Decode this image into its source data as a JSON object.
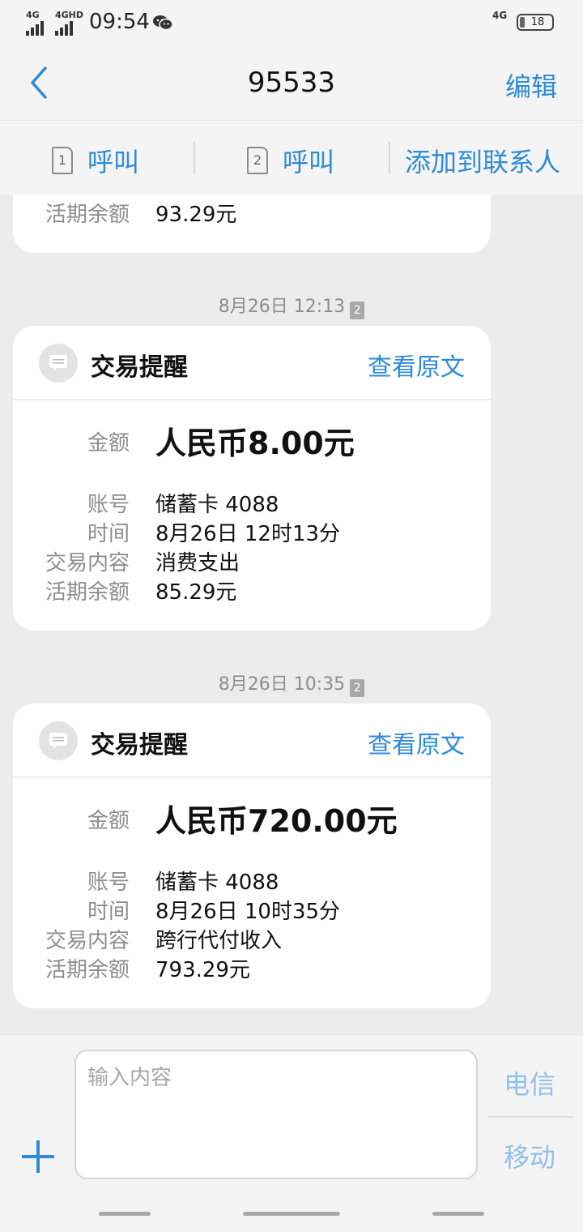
{
  "status_bar": {
    "sim1_network": "4G",
    "sim2_network": "4GHD",
    "time": "09:54",
    "right_network": "4G",
    "battery": "18"
  },
  "header": {
    "back_icon": "chevron-left-icon",
    "title": "95533",
    "edit_label": "编辑"
  },
  "actions": {
    "call1_sim": "1",
    "call1_label": "呼叫",
    "call2_sim": "2",
    "call2_label": "呼叫",
    "add_contact_label": "添加到联系人"
  },
  "messages": [
    {
      "partial": true,
      "fields": [
        {
          "label": "活期余额",
          "value": "93.29元"
        }
      ]
    },
    {
      "timestamp": "8月26日 12:13",
      "sim_badge": "2",
      "title": "交易提醒",
      "view_label": "查看原文",
      "amount_label": "金额",
      "amount": "人民币8.00元",
      "fields": [
        {
          "label": "账号",
          "value": "储蓄卡 4088"
        },
        {
          "label": "时间",
          "value": "8月26日 12时13分"
        },
        {
          "label": "交易内容",
          "value": "消费支出"
        },
        {
          "label": "活期余额",
          "value": "85.29元"
        }
      ]
    },
    {
      "timestamp": "8月26日 10:35",
      "sim_badge": "2",
      "title": "交易提醒",
      "view_label": "查看原文",
      "amount_label": "金额",
      "amount": "人民币720.00元",
      "fields": [
        {
          "label": "账号",
          "value": "储蓄卡 4088"
        },
        {
          "label": "时间",
          "value": "8月26日 10时35分"
        },
        {
          "label": "交易内容",
          "value": "跨行代付收入"
        },
        {
          "label": "活期余额",
          "value": "793.29元"
        }
      ]
    }
  ],
  "composer": {
    "placeholder": "输入内容",
    "send_telecom": "电信",
    "send_mobile": "移动"
  },
  "colors": {
    "accent": "#2e8bd8",
    "background": "#ececec",
    "card": "#ffffff",
    "muted_text": "#8d8d8d"
  }
}
